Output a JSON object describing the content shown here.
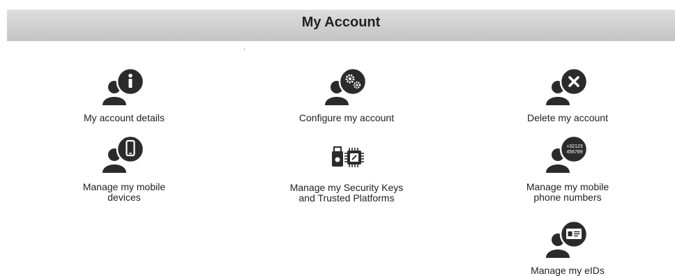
{
  "header": {
    "title": "My Account"
  },
  "tiles": {
    "account_details": {
      "label": "My account details",
      "icon": "user-info-icon"
    },
    "configure_account": {
      "label": "Configure my account",
      "icon": "user-gears-icon"
    },
    "delete_account": {
      "label": "Delete my account",
      "icon": "user-delete-icon"
    },
    "mobile_devices": {
      "label": "Manage my mobile devices",
      "icon": "user-mobile-icon"
    },
    "security_keys": {
      "label": "Manage my Security Keys and Trusted Platforms",
      "icon": "security-key-chip-icon"
    },
    "phone_numbers": {
      "label": "Manage my mobile phone numbers",
      "icon": "user-phone-numbers-icon",
      "badge_text": [
        "+32123",
        "456789"
      ]
    },
    "eids": {
      "label": "Manage my eIDs",
      "icon": "user-eid-icon"
    }
  },
  "colors": {
    "icon_dark": "#2b2b2b",
    "header_bg": "#d3d3d3"
  }
}
